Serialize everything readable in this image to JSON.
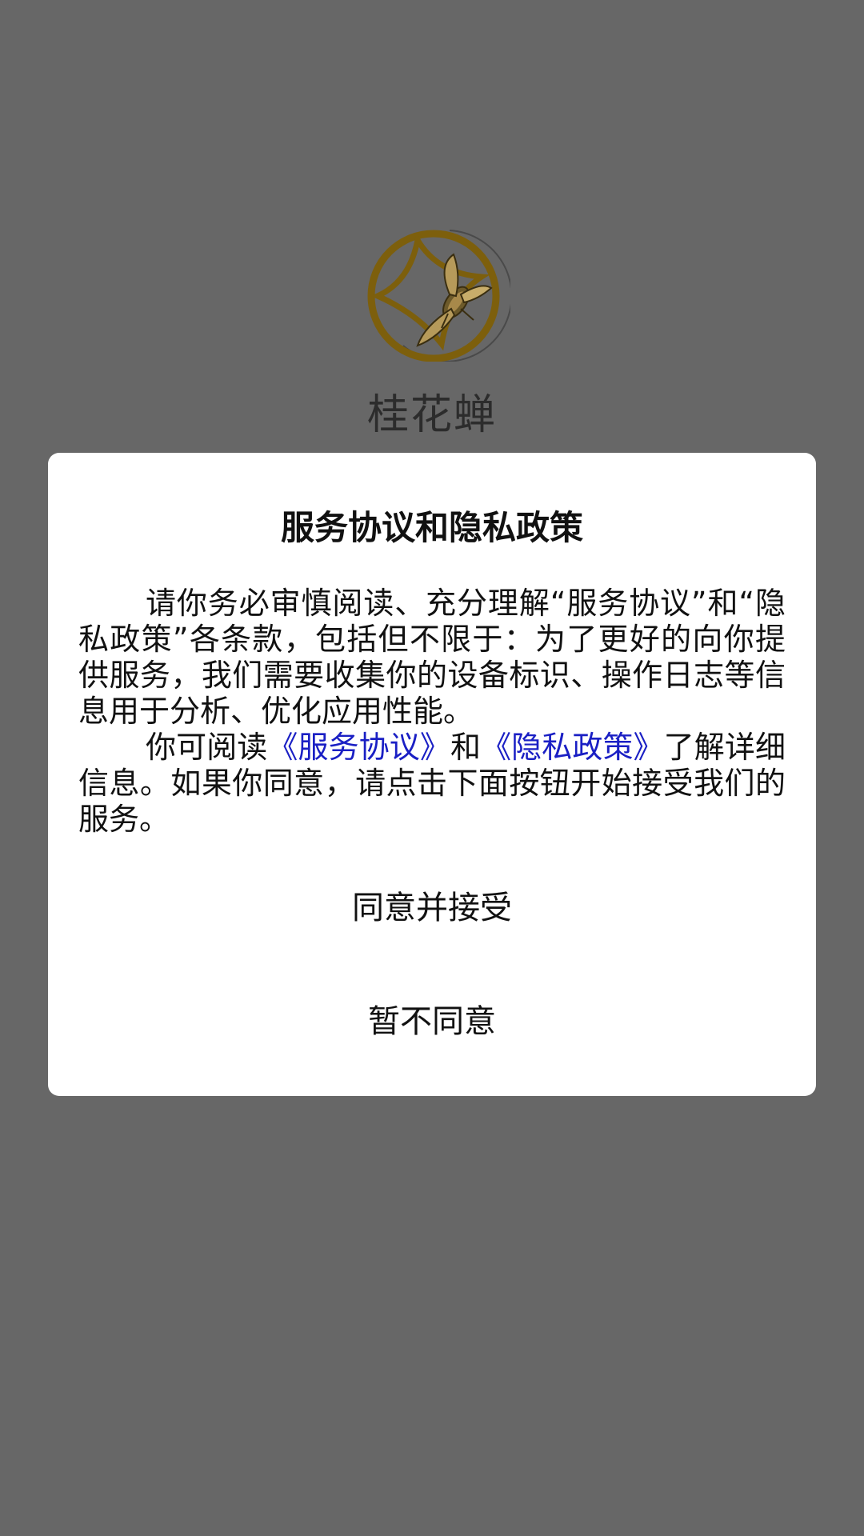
{
  "app": {
    "name": "桂花蝉"
  },
  "dialog": {
    "title": "服务协议和隐私政策",
    "paragraph1": "请你务必审慎阅读、充分理解“服务协议”和“隐私政策”各条款，包括但不限于：为了更好的向你提供服务，我们需要收集你的设备标识、操作日志等信息用于分析、优化应用性能。",
    "paragraph2": {
      "prefix": "你可阅读",
      "service_link": "《服务协议》",
      "middle": "和",
      "privacy_link": "《隐私政策》",
      "suffix": "了解详细信息。如果你同意，请点击下面按钮开始接受我们的服务。"
    },
    "agree_button": "同意并接受",
    "disagree_button": "暂不同意"
  },
  "colors": {
    "background_overlay": "#676767",
    "dialog_background": "#ffffff",
    "link": "#1a1fc4",
    "logo_gold": "#8a6a10"
  },
  "icons": {
    "logo": "cicada-circle-logo-icon"
  }
}
